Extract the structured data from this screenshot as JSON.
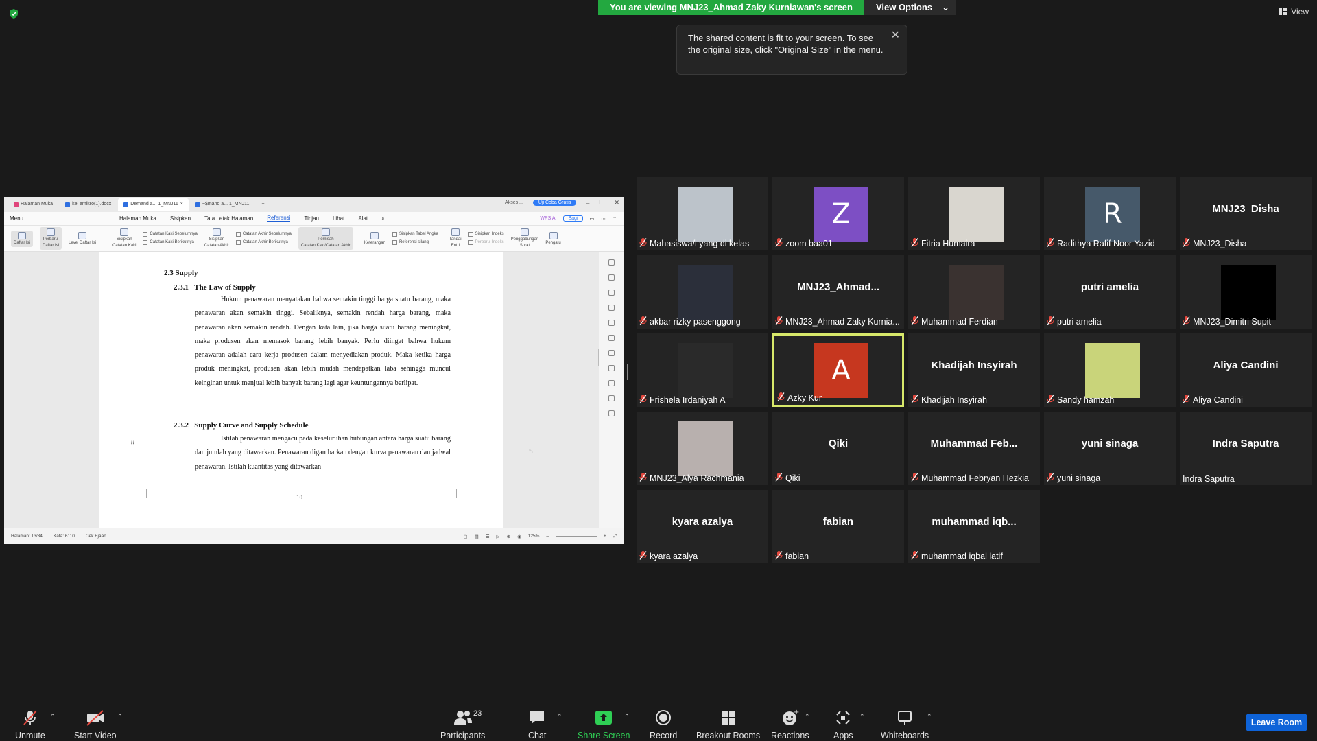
{
  "banner": {
    "message": "You are viewing MNJ23_Ahmad Zaky Kurniawan's screen",
    "view_options": "View Options"
  },
  "top_view": "View",
  "tooltip": {
    "text": "The shared content is fit to your screen. To see the original size, click \"Original Size\" in the menu."
  },
  "doc": {
    "tabs": [
      "Halaman Muka",
      "kel emikro(1).docx",
      "Demand a... 1_MNJ11",
      "~$mand a... 1_MNJ11"
    ],
    "top_right": [
      "Akses ...",
      "Uji Coba Gratis"
    ],
    "menu": [
      "Menu",
      "Halaman Muka",
      "Sisipkan",
      "Tata Letak Halaman",
      "Referensi",
      "Tinjau",
      "Lihat",
      "Alat"
    ],
    "menu_right": [
      "WPS AI",
      "Bagi"
    ],
    "ribbon": {
      "daftar_isi": "Daftar Isi",
      "perbarui": [
        "Perbarui",
        "Daftar Isi"
      ],
      "level": "Level Daftar Isi",
      "sisipkan_catatan_kaki": [
        "Sisipkan",
        "Catatan Kaki"
      ],
      "catatan_kaki_sebelumnya": "Catatan Kaki Sebelumnya",
      "catatan_kaki_berikutnya": "Catatan Kaki Berikutnya",
      "sisipkan_catatan_akhir": [
        "Sisipkan",
        "Catatan Akhir"
      ],
      "catatan_akhir_sebelumnya": "Catatan Akhir Sebelumnya",
      "catatan_akhir_berikutnya": "Catatan Akhir Berikutnya",
      "pemisah": [
        "Pemisah",
        "Catatan Kaki/Catatan Akhir"
      ],
      "keterangan": "Keterangan",
      "sisipkan_tabel_angka": "Sisipkan Tabel Angka",
      "referensi_silang": "Referensi silang",
      "tandai_entri": [
        "Tandai",
        "Entri"
      ],
      "sisipkan_indeks": "Sisipkan Indeks",
      "perbarui_indeks": "Perbarui Indeks",
      "penggabungan_surat": [
        "Penggabungan",
        "Surat"
      ],
      "pengaturan": "Pengatu"
    },
    "heading1": "2.3 Supply",
    "heading2a_num": "2.3.1",
    "heading2a": "The Law of Supply",
    "para1": "Hukum penawaran menyatakan bahwa semakin tinggi harga suatu barang, maka penawaran akan semakin tinggi. Sebaliknya, semakin rendah harga barang, maka penawaran akan semakin rendah. Dengan kata lain, jika harga suatu barang meningkat, maka produsen akan memasok barang lebih banyak. Perlu diingat bahwa hukum penawaran adalah cara kerja produsen dalam menyediakan produk. Maka ketika harga produk meningkat, produsen akan lebih mudah mendapatkan laba sehingga muncul keinginan untuk menjual lebih banyak barang lagi agar keuntungannya berlipat.",
    "heading2b_num": "2.3.2",
    "heading2b": "Supply Curve and Supply Schedule",
    "para2": "Istilah penawaran mengacu pada keseluruhan hubungan antara harga suatu barang dan jumlah yang ditawarkan. Penawaran digambarkan dengan kurva penawaran dan jadwal penawaran. Istilah kuantitas yang ditawarkan",
    "page_number": "10",
    "status": {
      "halaman": "Halaman: 13/34",
      "kata": "Kata: 6110",
      "cek": "Cek Ejaan",
      "zoom": "125%"
    }
  },
  "participants_tiles": [
    {
      "label": "Mahasiswa/i yang di kelas",
      "type": "photo",
      "color": "#bcc3ca",
      "muted": true
    },
    {
      "label": "zoom baa01",
      "type": "avatar",
      "letter": "Z",
      "color": "#7d4fc4",
      "muted": true
    },
    {
      "label": "Fitria Humaira",
      "type": "photo",
      "color": "#d9d6cf",
      "muted": true
    },
    {
      "label": "Radithya Rafif Noor Yazid",
      "type": "avatar",
      "letter": "R",
      "color": "#46596a",
      "muted": true
    },
    {
      "label": "MNJ23_Disha",
      "type": "name",
      "big": "MNJ23_Disha",
      "muted": true
    },
    {
      "label": "akbar rizky pasenggong",
      "type": "photo",
      "color": "#2b2f3a",
      "muted": true
    },
    {
      "label": "MNJ23_Ahmad Zaky Kurnia...",
      "type": "name",
      "big": "MNJ23_Ahmad...",
      "muted": true
    },
    {
      "label": "Muhammad Ferdian",
      "type": "photo",
      "color": "#3a3230",
      "muted": true
    },
    {
      "label": "putri amelia",
      "type": "name",
      "big": "putri amelia",
      "muted": true
    },
    {
      "label": "MNJ23_Dimitri Supit",
      "type": "photo",
      "color": "#000000",
      "muted": true
    },
    {
      "label": "Frishela Irdaniyah A",
      "type": "photo",
      "color": "#2a2a2a",
      "muted": true
    },
    {
      "label": "Azky Kur",
      "type": "avatar",
      "letter": "A",
      "color": "#c6371f",
      "muted": true,
      "active": true
    },
    {
      "label": "Khadijah Insyirah",
      "type": "name",
      "big": "Khadijah Insyirah",
      "muted": true
    },
    {
      "label": "Sandy hamzah",
      "type": "photo",
      "color": "#c9d47a",
      "muted": true
    },
    {
      "label": "Aliya Candini",
      "type": "name",
      "big": "Aliya Candini",
      "muted": true
    },
    {
      "label": "MNJ23_Alya Rachmania",
      "type": "photo",
      "color": "#b8b0ae",
      "muted": true
    },
    {
      "label": "Qiki",
      "type": "name",
      "big": "Qiki",
      "muted": true
    },
    {
      "label": "Muhammad Febryan Hezkia",
      "type": "name",
      "big": "Muhammad  Feb...",
      "muted": true
    },
    {
      "label": "yuni sinaga",
      "type": "name",
      "big": "yuni sinaga",
      "muted": true
    },
    {
      "label": "Indra Saputra",
      "type": "name",
      "big": "Indra Saputra",
      "muted": false
    },
    {
      "label": "kyara azalya",
      "type": "name",
      "big": "kyara azalya",
      "muted": true
    },
    {
      "label": "fabian",
      "type": "name",
      "big": "fabian",
      "muted": true
    },
    {
      "label": "muhammad iqbal latif",
      "type": "name",
      "big": "muhammad  iqb...",
      "muted": true
    }
  ],
  "toolbar": {
    "unmute": "Unmute",
    "start_video": "Start Video",
    "participants": "Participants",
    "participants_count": "23",
    "chat": "Chat",
    "share_screen": "Share Screen",
    "record": "Record",
    "breakout_rooms": "Breakout Rooms",
    "reactions": "Reactions",
    "apps": "Apps",
    "whiteboards": "Whiteboards",
    "leave_room": "Leave Room"
  },
  "colors": {
    "green": "#23a840",
    "leave": "#0e63d8",
    "active_border": "#d7e86a",
    "muted_red": "#e5483e"
  }
}
